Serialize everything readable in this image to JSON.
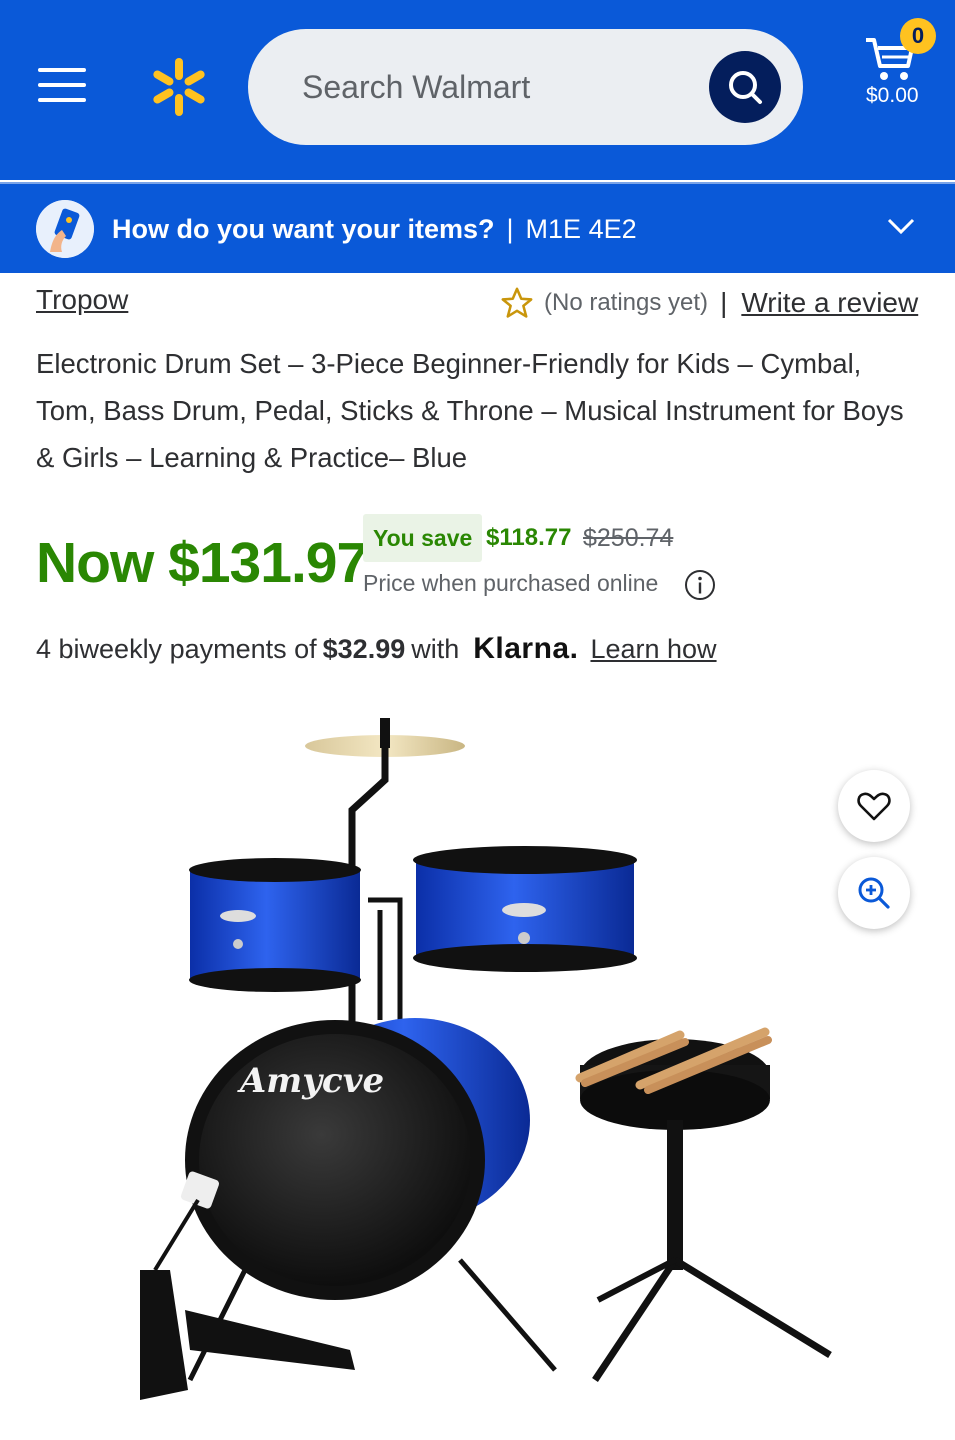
{
  "header": {
    "search_placeholder": "Search Walmart",
    "cart_count": "0",
    "cart_total": "$0.00",
    "icons": {
      "menu": "hamburger-icon",
      "logo": "walmart-spark-icon",
      "search": "search-icon",
      "cart": "cart-icon"
    },
    "colors": {
      "brand_blue": "#0a59d8",
      "spark_yellow": "#ffc220",
      "search_button": "#041e5c"
    }
  },
  "delivery": {
    "prompt": "How do you want your items?",
    "separator": "|",
    "postal_code": "M1E 4E2"
  },
  "product": {
    "brand": "Tropow",
    "rating_text": "(No ratings yet)",
    "rating_separator": "|",
    "write_review": "Write a review",
    "title": "Electronic Drum Set – 3-Piece Beginner-Friendly for Kids – Cymbal, Tom, Bass Drum, Pedal, Sticks & Throne – Musical Instrument for Boys & Girls – Learning & Practice– Blue",
    "price_now": "Now $131.97",
    "you_save_label": "You save",
    "save_amount": "$118.77",
    "was_price": "$250.74",
    "price_note": "Price when purchased online",
    "drum_brand_text": "Amycve",
    "colors": {
      "price_green": "#2a8703",
      "drum_blue": "#1f4fd6"
    }
  },
  "klarna": {
    "prefix": "4 biweekly payments of",
    "amount": "$32.99",
    "with": "with",
    "logo": "Klarna.",
    "learn_how": "Learn how"
  }
}
